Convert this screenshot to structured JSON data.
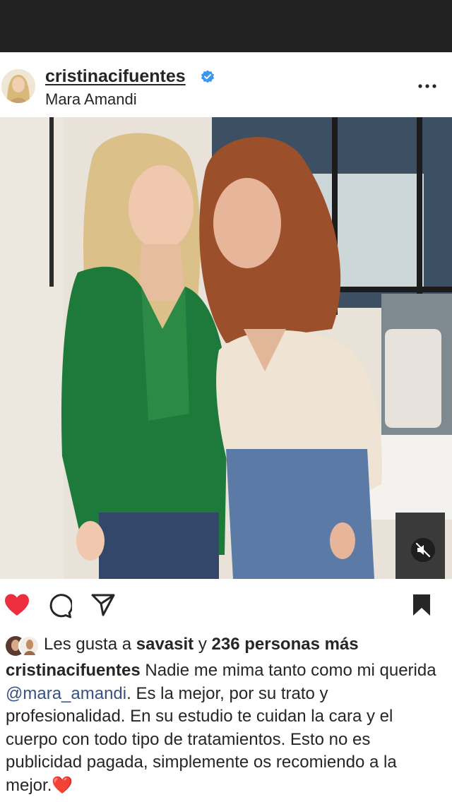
{
  "post": {
    "username": "cristinacifuentes",
    "location": "Mara Amandi"
  },
  "colors": {
    "like": "#ed2e3f",
    "verified": "#3897f0",
    "mention": "#385185",
    "status_bar": "#222222"
  },
  "icons": {
    "like": "heart-icon",
    "comment": "comment-icon",
    "share": "send-icon",
    "save": "bookmark-icon",
    "more": "more-options-icon",
    "verified": "verified-badge-icon",
    "mute": "muted-audio-icon"
  },
  "likes": {
    "prefix": "Les gusta a",
    "user": "savasit",
    "connector": "y",
    "count_text": "236 personas más"
  },
  "caption": {
    "author": "cristinacifuentes",
    "text_before_mention": " Nadie me mima tanto como mi querida ",
    "mention": "@mara_amandi",
    "text_after_mention": ". Es la mejor, por su trato y profesionalidad. En su estudio te cuidan la cara y el cuerpo con todo tipo de tratamientos. Esto no es publicidad pagada, simplemente os recomiendo a la mejor.",
    "emoji": "❤️"
  }
}
